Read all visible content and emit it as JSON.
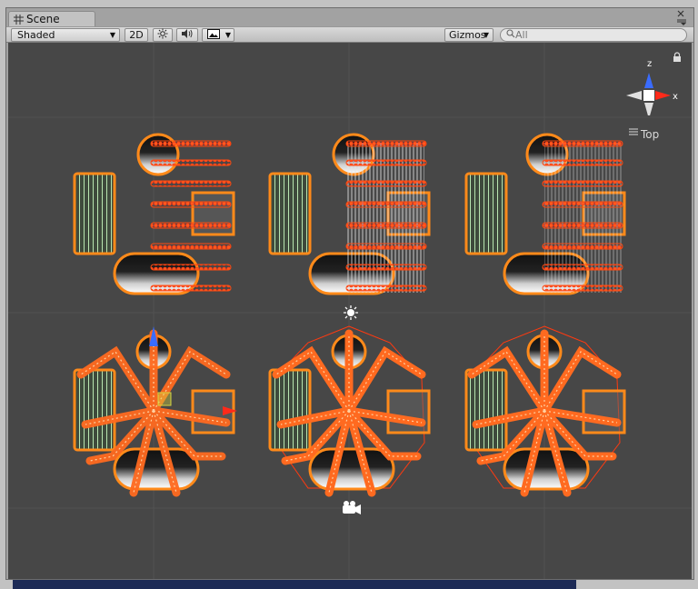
{
  "window": {
    "tab_label": "Scene"
  },
  "toolbar": {
    "draw_mode": "Shaded",
    "mode_2d_label": "2D",
    "gizmos_label": "Gizmos",
    "search_placeholder": "All"
  },
  "orientation": {
    "axis_z": "z",
    "axis_x": "x",
    "view_label": "Top"
  },
  "colors": {
    "viewport_bg": "#474747",
    "selection_outline": "#ff7a1a",
    "joint_handle": "#ff3a1a",
    "collider_green": "#aee0a8",
    "axis_z": "#3a6cff",
    "axis_x": "#ff2a1a"
  }
}
